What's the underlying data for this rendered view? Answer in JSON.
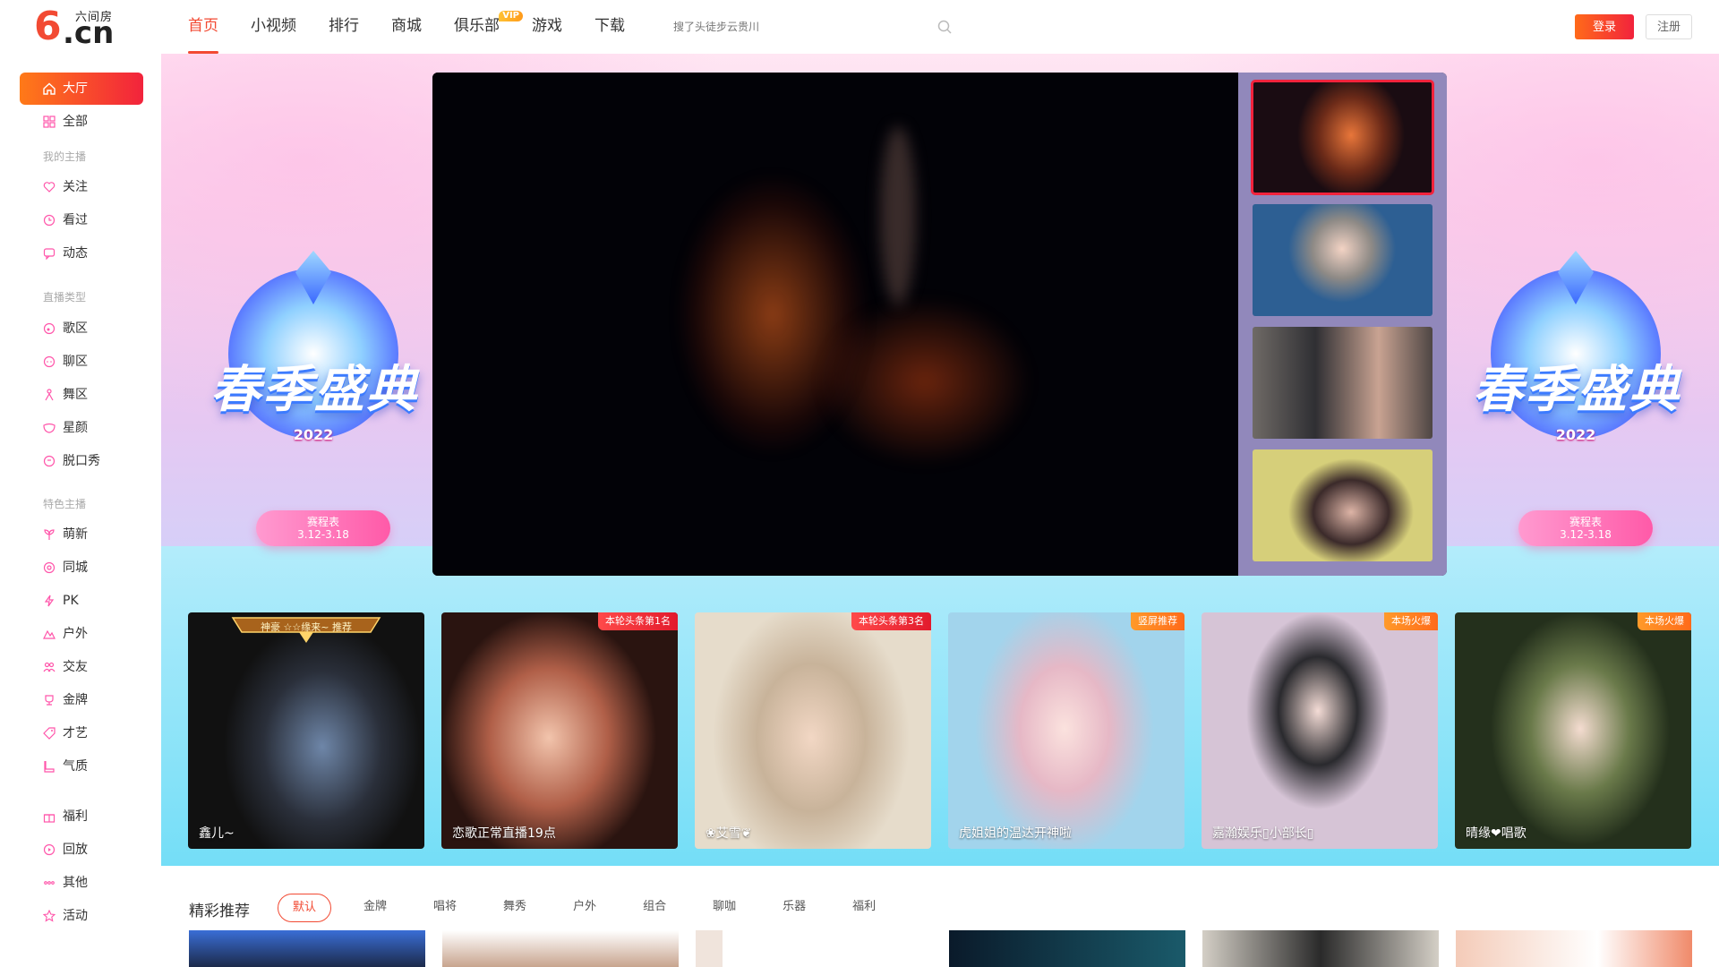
{
  "header": {
    "logo_mark": "6",
    "logo_domain": ".cn",
    "logo_sitename": "六间房",
    "nav": [
      {
        "label": "首页",
        "active": true
      },
      {
        "label": "小视频"
      },
      {
        "label": "排行"
      },
      {
        "label": "商城"
      },
      {
        "label": "俱乐部",
        "badge": "VIP"
      },
      {
        "label": "游戏"
      },
      {
        "label": "下载"
      }
    ],
    "search_placeholder": "搜了头徒步云贵川",
    "login": "登录",
    "register": "注册"
  },
  "sidebar": {
    "hall": "大厅",
    "all": "全部",
    "group_mine": "我的主播",
    "mine": [
      "关注",
      "看过",
      "动态"
    ],
    "group_types": "直播类型",
    "types": [
      "歌区",
      "聊区",
      "舞区",
      "星颜",
      "脱口秀"
    ],
    "group_special": "特色主播",
    "special": [
      "萌新",
      "同城",
      "PK",
      "户外",
      "交友",
      "金牌",
      "才艺",
      "气质"
    ],
    "others": [
      "福利",
      "回放",
      "其他",
      "活动"
    ]
  },
  "banner": {
    "title": "春季盛典",
    "year": "2022",
    "pill_line1": "赛程表",
    "pill_line2": "3.12-3.18"
  },
  "cards": [
    {
      "name": "鑫儿~",
      "crown_text": "神豪 ☆☆缘来~ 推荐"
    },
    {
      "name": "恋歌正常直播19点",
      "tag": "本轮头条第1名"
    },
    {
      "name": "❀艾雪❦",
      "tag": "本轮头条第3名"
    },
    {
      "name": "虎姐姐的温达开神啦",
      "tag": "竖屏推荐"
    },
    {
      "name": "嘉瀚娱乐▯小部长▯",
      "tag": "本场火爆"
    },
    {
      "name": "晴缘❤唱歌",
      "tag": "本场火爆"
    }
  ],
  "recommend": {
    "title": "精彩推荐",
    "filters": [
      "默认",
      "金牌",
      "唱将",
      "舞秀",
      "户外",
      "组合",
      "聊咖",
      "乐器",
      "福利"
    ]
  },
  "colors": {
    "accent": "#f24a33",
    "cyan": "#74def7"
  }
}
